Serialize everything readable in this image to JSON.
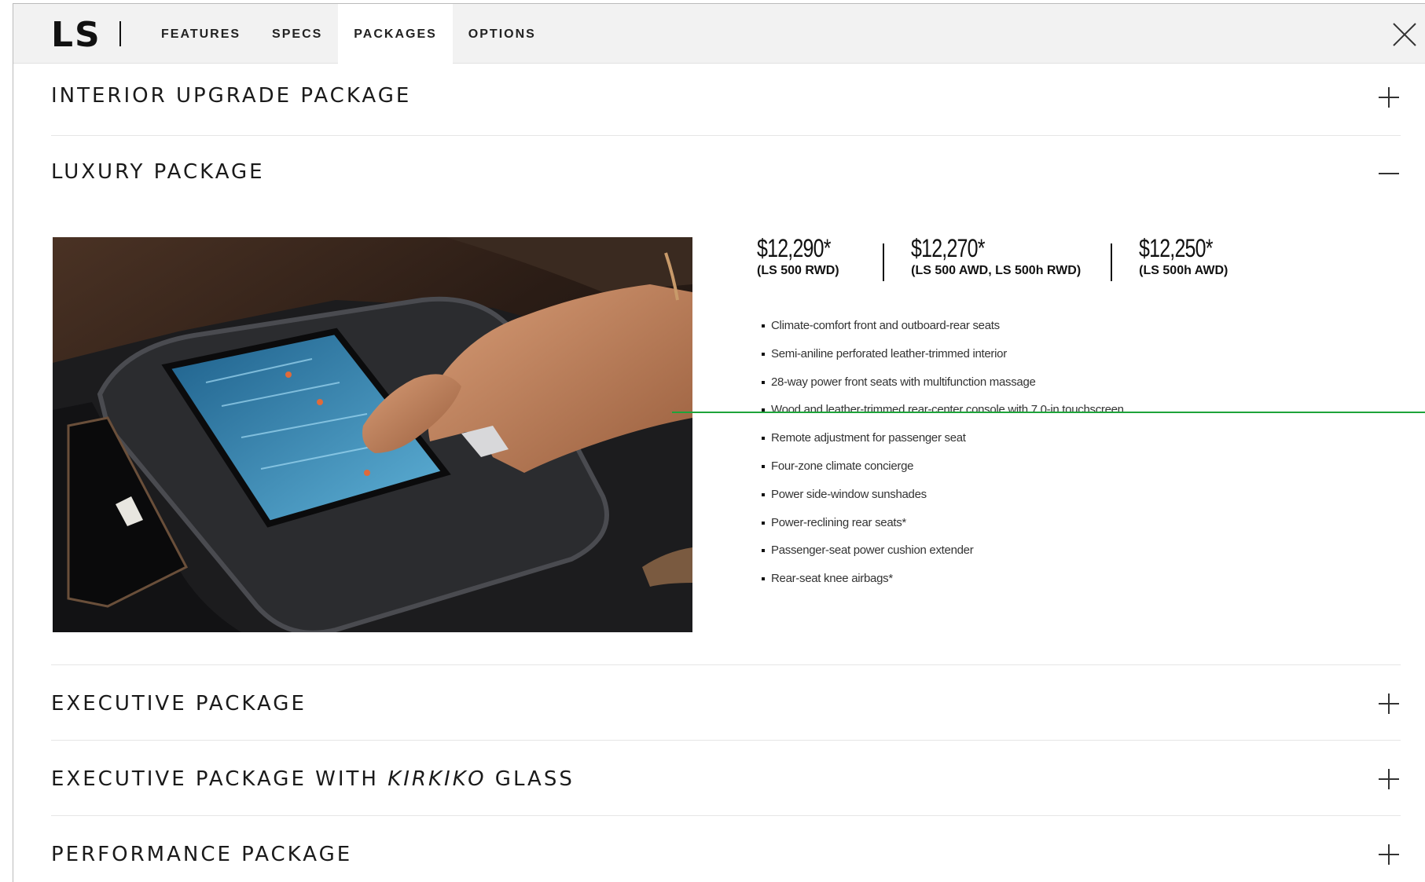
{
  "header": {
    "logo": "LS",
    "tabs": [
      {
        "label": "FEATURES"
      },
      {
        "label": "SPECS"
      },
      {
        "label": "PACKAGES"
      },
      {
        "label": "OPTIONS"
      }
    ],
    "active_tab": "PACKAGES",
    "close_icon": "close-x-icon"
  },
  "packages": {
    "interior_upgrade": {
      "title": "INTERIOR UPGRADE PACKAGE",
      "toggle": "+"
    },
    "luxury": {
      "title": "LUXURY PACKAGE",
      "toggle": "—",
      "prices": [
        {
          "price": "$12,290*",
          "note": "(LS 500 RWD)"
        },
        {
          "price": "$12,270*",
          "note": "(LS 500 AWD, LS 500h RWD)"
        },
        {
          "price": "$12,250*",
          "note": "(LS 500h AWD)"
        }
      ],
      "features": [
        "Climate-comfort front and outboard-rear seats",
        "Semi-aniline perforated leather-trimmed interior",
        "28-way power front seats with multifunction massage",
        "Wood and leather-trimmed rear-center console with 7.0-in touchscreen",
        "Remote adjustment for passenger seat",
        "Four-zone climate concierge",
        "Power side-window sunshades",
        "Power-reclining rear seats*",
        "Passenger-seat power cushion extender",
        "Rear-seat knee airbags*"
      ]
    },
    "executive": {
      "title": "EXECUTIVE PACKAGE",
      "toggle": "+"
    },
    "executive_kirikiko": {
      "title_pre": "EXECUTIVE PACKAGE WITH ",
      "title_italic": "KIRKIKO",
      "title_post": " GLASS",
      "toggle": "+"
    },
    "performance": {
      "title": "PERFORMANCE PACKAGE",
      "toggle": "+"
    }
  },
  "colors": {
    "accent_line": "#1ea43a",
    "topbar_bg": "#f2f2f2"
  }
}
